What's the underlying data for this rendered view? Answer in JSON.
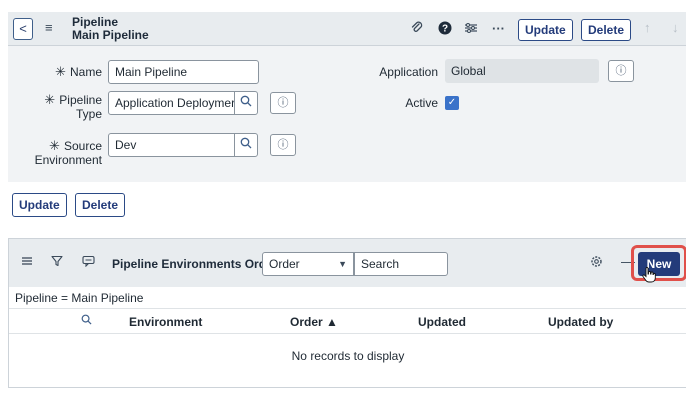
{
  "header": {
    "back": "<",
    "menu": "≡",
    "title_line1": "Pipeline",
    "title_line2": "Main Pipeline",
    "update": "Update",
    "delete": "Delete",
    "up_arrow": "↑",
    "down_arrow": "↓"
  },
  "form": {
    "name_label": "Name",
    "name_value": "Main Pipeline",
    "pipeline_type_label_1": "Pipeline",
    "pipeline_type_label_2": "Type",
    "pipeline_type_value": "Application Deploymer",
    "source_env_label_1": "Source",
    "source_env_label_2": "Environment",
    "source_env_value": "Dev",
    "application_label": "Application",
    "application_value": "Global",
    "active_label": "Active",
    "required_mark": "✳",
    "info_glyph": "ⓘ"
  },
  "buttons": {
    "update": "Update",
    "delete": "Delete"
  },
  "related_list": {
    "title": "Pipeline Environments Order",
    "select_value": "Order",
    "search_value": "Search",
    "new_button": "New",
    "breadcrumb": "Pipeline = Main Pipeline",
    "columns": [
      "Environment",
      "Order ▲",
      "Updated",
      "Updated by"
    ],
    "empty_message": "No records to display"
  }
}
